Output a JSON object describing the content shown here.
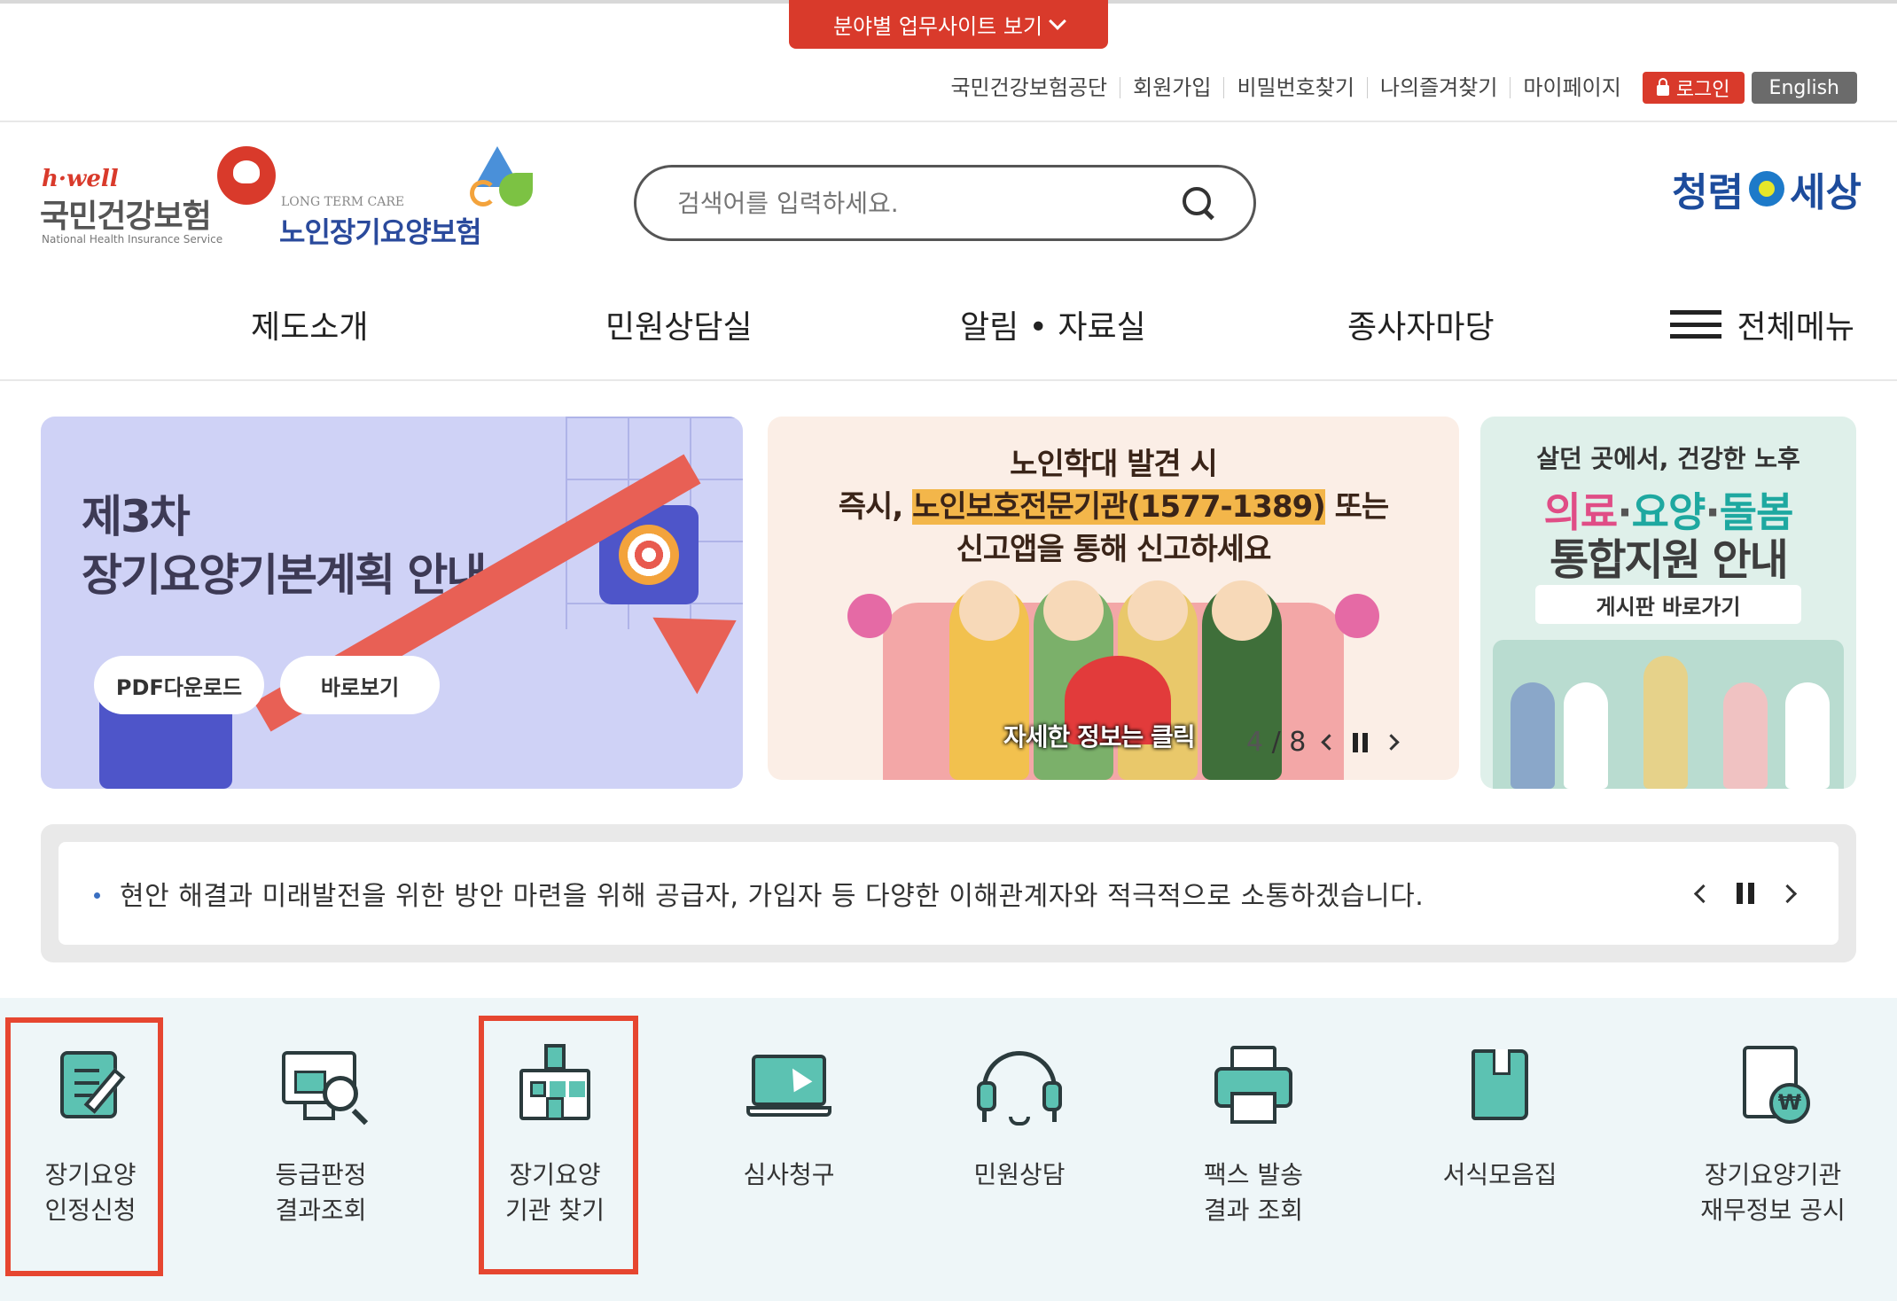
{
  "header": {
    "site_toggle_label": "분야별 업무사이트 보기",
    "util_links": [
      "국민건강보험공단",
      "회원가입",
      "비밀번호찾기",
      "나의즐겨찾기",
      "마이페이지"
    ],
    "login_label": "로그인",
    "english_label": "English"
  },
  "logos": {
    "nhis_brand": "h·well",
    "nhis_name": "국민건강보험",
    "nhis_english": "National Health Insurance Service",
    "ltc_small": "LONG TERM CARE",
    "ltc_name": "노인장기요양보험",
    "clean_left": "청렴",
    "clean_right": "세상"
  },
  "search": {
    "placeholder": "검색어를 입력하세요."
  },
  "gnb": {
    "items": [
      "제도소개",
      "민원상담실",
      "알림 • 자료실",
      "종사자마당"
    ],
    "all_menu_label": "전체메뉴"
  },
  "banners": {
    "b1": {
      "line1": "제3차",
      "line2": "장기요양기본계획 안내",
      "pdf_button": "PDF다운로드",
      "view_button": "바로보기"
    },
    "b2": {
      "line1": "노인학대 발견 시",
      "line2_pre": "즉시, ",
      "line2_hl": "노인보호전문기관(1577-1389)",
      "line2_post": " 또는",
      "line3": "신고앱을 통해 신고하세요",
      "click_text": "자세한 정보는 클릭",
      "pager_current": "4",
      "pager_sep": "/",
      "pager_total": "8"
    },
    "b3": {
      "line1": "살던 곳에서, 건강한 노후",
      "w1": "의료",
      "dot1": "·",
      "w2": "요양",
      "dot2": "·",
      "w3": "돌봄",
      "line3": "통합지원 안내",
      "button": "게시판 바로가기"
    }
  },
  "notice": {
    "text": "현안 해결과 미래발전을 위한 방안 마련을 위해 공급자, 가입자 등 다양한 이해관계자와 적극적으로 소통하겠습니다."
  },
  "quick": {
    "items": [
      {
        "label": "장기요양\n인정신청",
        "icon": "document-pen-icon"
      },
      {
        "label": "등급판정\n결과조회",
        "icon": "monitor-search-icon"
      },
      {
        "label": "장기요양\n기관 찾기",
        "icon": "hospital-icon"
      },
      {
        "label": "심사청구",
        "icon": "laptop-cursor-icon"
      },
      {
        "label": "민원상담",
        "icon": "headset-icon"
      },
      {
        "label": "팩스 발송\n결과 조회",
        "icon": "fax-icon"
      },
      {
        "label": "서식모음집",
        "icon": "book-icon"
      },
      {
        "label": "장기요양기관\n재무정보 공시",
        "icon": "finance-document-icon"
      }
    ]
  },
  "colors": {
    "brand_red": "#d93a2b",
    "highlight_red": "#e64630",
    "icon_teal": "#5cc2b2",
    "quick_bg": "#eef6f8"
  }
}
